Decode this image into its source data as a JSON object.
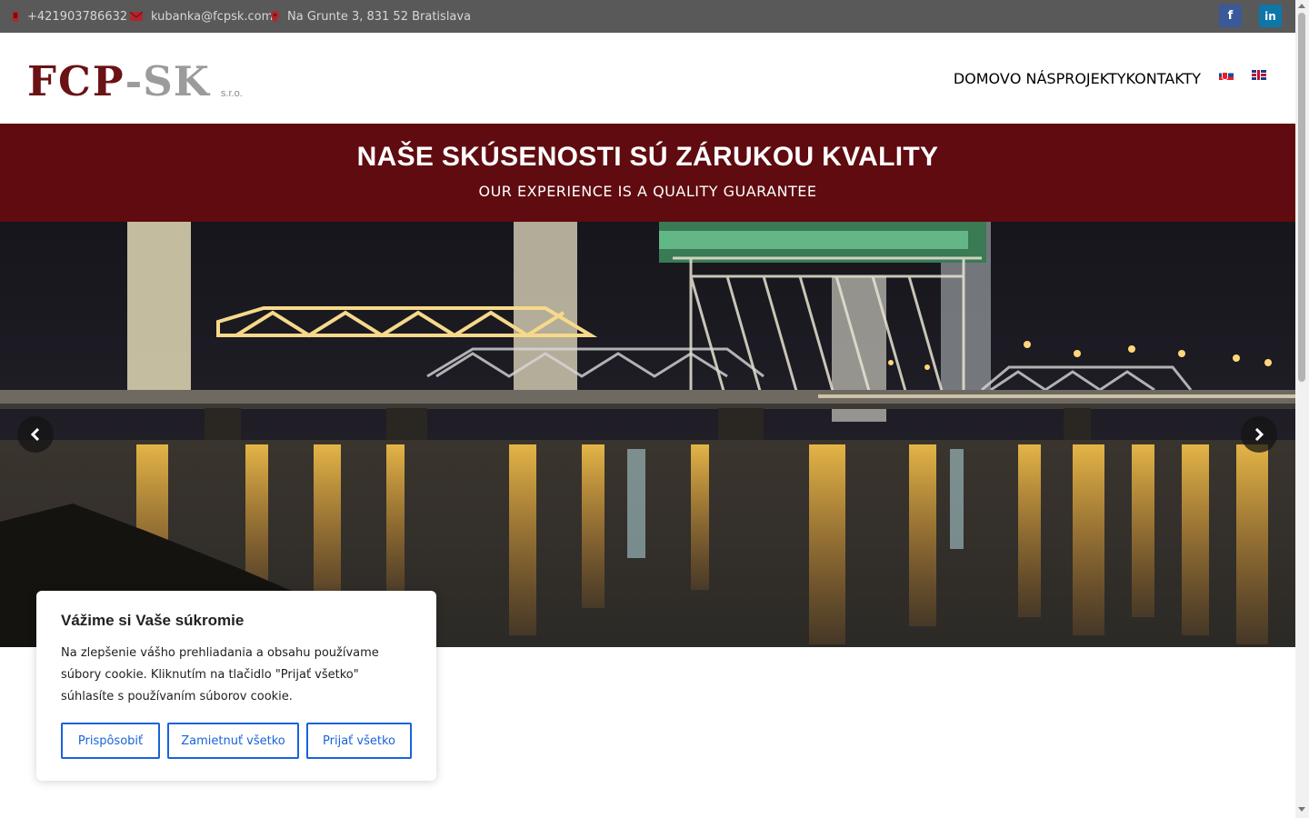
{
  "topbar": {
    "phone": "+421903786632",
    "email": "kubanka@fcpsk.com",
    "address": "Na Grunte 3, 831 52 Bratislava",
    "phone_icon": "mobile-phone-icon",
    "email_icon": "envelope-icon",
    "address_icon": "map-marker-icon",
    "social": [
      {
        "name": "facebook",
        "glyph": "f",
        "color": "#3b5998"
      },
      {
        "name": "linkedin",
        "glyph": "in",
        "color": "#0e76a8"
      }
    ]
  },
  "logo": {
    "part1": "FCP",
    "part2": "-SK",
    "suffix": "s.r.o."
  },
  "nav": {
    "items": [
      {
        "label": "DOMOV",
        "active": true
      },
      {
        "label": "O NÁS",
        "active": false
      },
      {
        "label": "PROJEKTY",
        "active": false
      },
      {
        "label": "KONTAKTY",
        "active": false
      }
    ],
    "languages": [
      "sk-flag-icon",
      "en-flag-icon"
    ]
  },
  "banner": {
    "title": "NAŠE SKÚSENOSTI SÚ ZÁRUKOU KVALITY",
    "subtitle": "OUR EXPERIENCE IS A QUALITY GUARANTEE",
    "background": "#5f0b10"
  },
  "slider": {
    "image": "illuminated lift bridge over river at night",
    "prev_icon": "chevron-left-icon",
    "next_icon": "chevron-right-icon"
  },
  "cookie": {
    "title": "Vážime si Vaše súkromie",
    "text": "Na zlepšenie vášho prehliadania a obsahu používame súbory cookie. Kliknutím na tlačidlo \"Prijať všetko\" súhlasíte s používaním súborov cookie.",
    "buttons": {
      "customize": "Prispôsobiť",
      "reject": "Zamietnuť všetko",
      "accept": "Prijať všetko"
    },
    "accent": "#1863dc"
  },
  "colors": {
    "brand": "#6e1214",
    "topbar": "#595959",
    "nav_text": "#6e6e6e"
  }
}
